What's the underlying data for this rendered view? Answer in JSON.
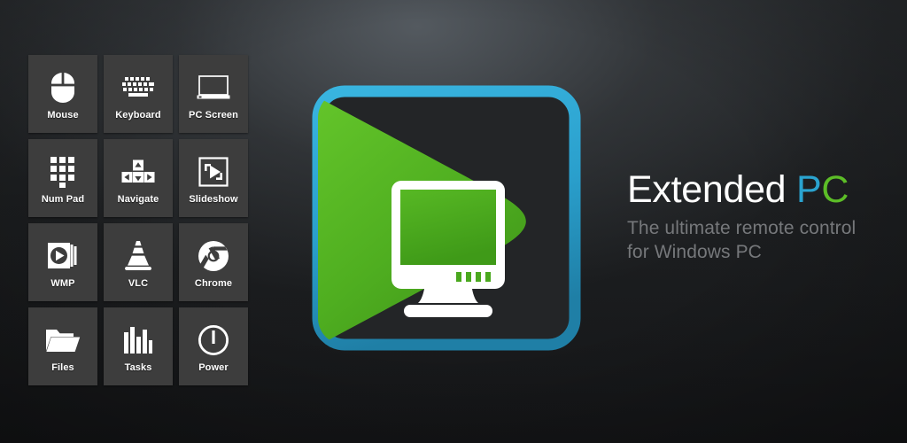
{
  "background": {
    "base_color": "#1d1f21",
    "highlight_color": "#5a6066"
  },
  "tile_grid": {
    "tile_color": "#3d3d3d",
    "label_color": "#ffffff",
    "tiles": [
      {
        "label": "Mouse",
        "icon": "mouse-icon"
      },
      {
        "label": "Keyboard",
        "icon": "keyboard-icon"
      },
      {
        "label": "PC Screen",
        "icon": "pc-screen-icon"
      },
      {
        "label": "Num Pad",
        "icon": "num-pad-icon"
      },
      {
        "label": "Navigate",
        "icon": "dpad-navigate-icon"
      },
      {
        "label": "Slideshow",
        "icon": "slideshow-icon"
      },
      {
        "label": "WMP",
        "icon": "windows-media-player-icon"
      },
      {
        "label": "VLC",
        "icon": "vlc-cone-icon"
      },
      {
        "label": "Chrome",
        "icon": "chrome-icon"
      },
      {
        "label": "Files",
        "icon": "folder-icon"
      },
      {
        "label": "Tasks",
        "icon": "bar-chart-tasks-icon"
      },
      {
        "label": "Power",
        "icon": "power-icon"
      }
    ]
  },
  "logo": {
    "name": "extended-pc-app-logo",
    "frame_color": "#2a9fcc",
    "play_shape_color": "#56b624",
    "screen_color": "#4aa81e",
    "bezel_color": "#ffffff"
  },
  "brand": {
    "title_main": "Extended",
    "title_accent_p": "P",
    "title_accent_c": "C",
    "subtitle_line1": "The ultimate remote control",
    "subtitle_line2": "for Windows PC",
    "accent_blue": "#2aa3cf",
    "accent_green": "#5cbd27",
    "subtitle_color": "#76787b"
  }
}
